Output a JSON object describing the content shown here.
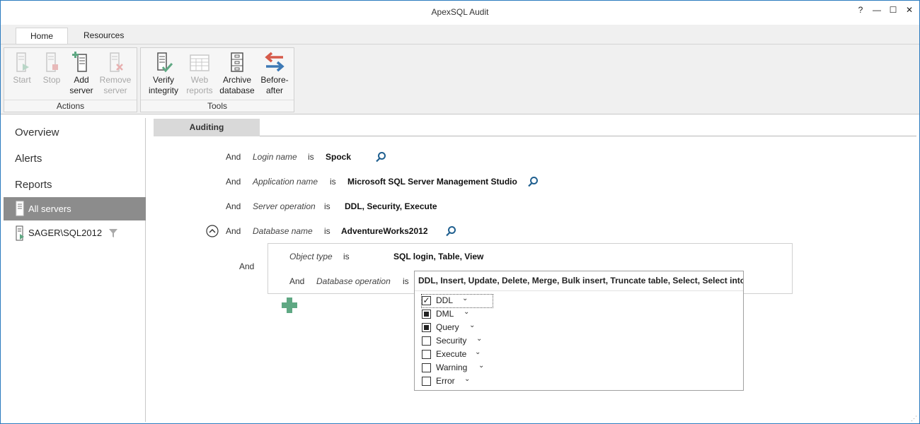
{
  "window": {
    "title": "ApexSQL Audit",
    "controls": {
      "help": "?",
      "minimize": "—",
      "maximize": "☐",
      "close": "✕"
    }
  },
  "ribbon": {
    "tabs": [
      {
        "label": "Home",
        "active": true
      },
      {
        "label": "Resources",
        "active": false
      }
    ],
    "groups": [
      {
        "label": "Actions",
        "buttons": [
          {
            "label": "Start",
            "enabled": false
          },
          {
            "label": "Stop",
            "enabled": false
          },
          {
            "label": "Add\nserver",
            "line1": "Add",
            "line2": "server",
            "enabled": true
          },
          {
            "label": "Remove\nserver",
            "line1": "Remove",
            "line2": "server",
            "enabled": false
          }
        ]
      },
      {
        "label": "Tools",
        "buttons": [
          {
            "line1": "Verify",
            "line2": "integrity",
            "enabled": true
          },
          {
            "line1": "Web",
            "line2": "reports",
            "enabled": false
          },
          {
            "line1": "Archive",
            "line2": "database",
            "enabled": true
          },
          {
            "line1": "Before-",
            "line2": "after",
            "enabled": true
          }
        ]
      }
    ]
  },
  "sidebar": {
    "links": [
      "Overview",
      "Alerts",
      "Reports"
    ],
    "selected": "All servers",
    "server": "SAGER\\SQL2012"
  },
  "main": {
    "tab": "Auditing",
    "conditions": [
      {
        "op": "And",
        "field": "Login name",
        "verb": "is",
        "value": "Spock"
      },
      {
        "op": "And",
        "field": "Application name",
        "verb": "is",
        "value": "Microsoft SQL Server Management Studio"
      },
      {
        "op": "And",
        "field": "Server operation",
        "verb": "is",
        "value": "DDL, Security, Execute"
      },
      {
        "op": "And",
        "field": "Database name",
        "verb": "is",
        "value": "AdventureWorks2012"
      }
    ],
    "group": {
      "op": "And",
      "conditions": [
        {
          "op": "",
          "field": "Object type",
          "verb": "is",
          "value": "SQL login, Table, View"
        },
        {
          "op": "And",
          "field": "Database operation",
          "verb": "is",
          "value": "DDL, Insert, Update, Delete, Merge, Bulk insert, Truncate table, Select, Select into"
        }
      ]
    },
    "dropdown": {
      "header": "DDL, Insert, Update, Delete, Merge, Bulk insert, Truncate table, Select, Select into",
      "options": [
        {
          "label": "DDL",
          "state": "checked"
        },
        {
          "label": "DML",
          "state": "partial"
        },
        {
          "label": "Query",
          "state": "partial"
        },
        {
          "label": "Security",
          "state": "unchecked"
        },
        {
          "label": "Execute",
          "state": "unchecked"
        },
        {
          "label": "Warning",
          "state": "unchecked"
        },
        {
          "label": "Error",
          "state": "unchecked"
        }
      ]
    }
  },
  "colors": {
    "accent": "#2b7bbf",
    "selected_nav": "#8c8c8c",
    "add_green": "#5fa883",
    "search_blue": "#1f5f8f"
  }
}
